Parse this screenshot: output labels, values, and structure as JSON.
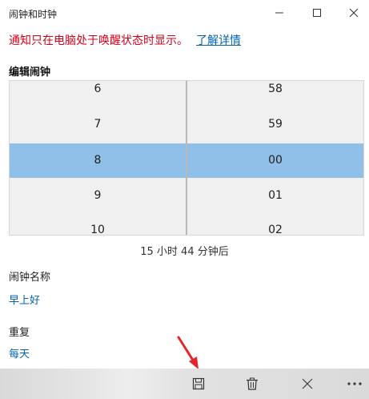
{
  "window": {
    "title": "闹钟和时钟",
    "controls": [
      "minimize-icon",
      "maximize-icon",
      "close-icon"
    ]
  },
  "notice": {
    "text": "通知只在电脑处于唤醒状态时显示。",
    "link": "了解详情"
  },
  "editor": {
    "section_title": "编辑闹钟",
    "hours": [
      "6",
      "7",
      "8",
      "9",
      "10"
    ],
    "minutes": [
      "58",
      "59",
      "00",
      "01",
      "02"
    ],
    "selected_hour": "8",
    "selected_minute": "00",
    "countdown": "15 小时 44 分钟后"
  },
  "alarm_name": {
    "label": "闹钟名称",
    "value": "早上好"
  },
  "repeat": {
    "label": "重复",
    "value": "每天"
  },
  "command_bar": {
    "icons": [
      "save-icon",
      "delete-icon",
      "close-icon",
      "more-icon"
    ]
  },
  "colors": {
    "accent": "#0063b1",
    "warning": "#d0021b",
    "selection": "#90bfe7",
    "picker_bg": "#f0f0f0"
  }
}
